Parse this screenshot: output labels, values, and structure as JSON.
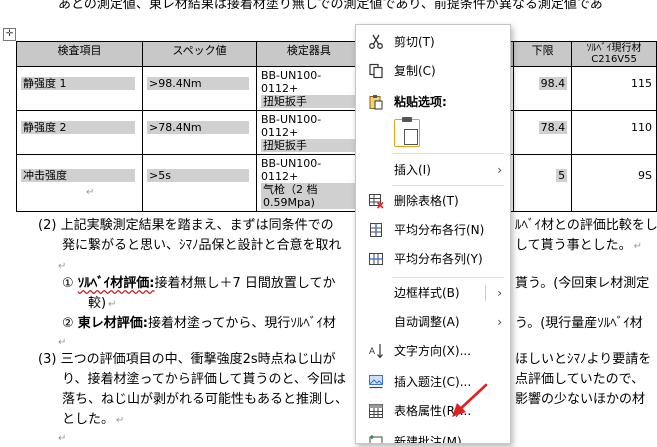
{
  "document": {
    "line_top": "あとの測定値、東レ材結果は接着材塗り無しでの測定値であり、前提条件が異なる測定値であ",
    "table": {
      "headers": [
        "検査項目",
        "スペック値",
        "検定器具",
        "",
        "下限",
        "ｿﾙﾍﾞｲ現行材 C216V55"
      ],
      "rows": [
        {
          "item": "静强度 1",
          "spec": ">98.4Nm",
          "tool_1": "BB-UN100-0112+",
          "tool_2": "扭矩扳手",
          "tool_3": "",
          "lower": "98.4",
          "current": "115"
        },
        {
          "item": "静强度 2",
          "spec": ">78.4Nm",
          "tool_1": "BB-UN100-0112+",
          "tool_2": "扭矩扳手",
          "tool_3": "",
          "lower": "78.4",
          "current": "110"
        },
        {
          "item": "冲击强度",
          "spec": ">5s",
          "tool_1": "BB-UN100-0112+",
          "tool_2": "气枪（2 档",
          "tool_3": "0.59Mpa)",
          "lower": "5",
          "current": "9S"
        }
      ]
    },
    "para2_num": "(2)",
    "para2_l1": "上記実験測定結果を踏まえ、まずは同条件での",
    "para2_l1b": "ﾙﾍﾞｲ材との評価比較をし",
    "para2_l2": "発に繋がると思い、ｼﾏﾉ品保と設計と合意を取れ",
    "para2_l2b": "して貰う事とした。",
    "item1_num": "①",
    "item1_bold": "ｿﾙﾍﾞｲ材評価:",
    "item1_text": "接着材無し＋7 日間放置してか",
    "item1_textb": "貰う。(今回東レ材測定",
    "item1_l2": "較)",
    "item2_num": "②",
    "item2_bold": "東レ材評価:",
    "item2_text": "接着材塗ってから、現行ｿﾙﾍﾞｲ材",
    "item2_textb": "う。(現行量産ｿﾙﾍﾞｲ材",
    "para3_num": "(3)",
    "para3_l1": "三つの評価項目の中、衝撃強度2s時点ねじ山が",
    "para3_l1b": "ほしいとｼﾏﾉより要請を",
    "para3_l2": "り、接着材塗ってから評価して貰うのと、今回は",
    "para3_l2b": "点評価していたので、",
    "para3_l3": "落ち、ねじ山が剥がれる可能性もあると推測し、",
    "para3_l3b": "影響の少ないほかの材",
    "para3_l4": "とした。"
  },
  "context_menu": {
    "items": [
      {
        "label": "剪切(T)",
        "icon": "scissors-icon"
      },
      {
        "label": "复制(C)",
        "icon": "copy-icon"
      },
      {
        "label": "粘贴选项:",
        "icon": "paste-icon"
      },
      {
        "label": "插入(I)",
        "icon": ""
      },
      {
        "label": "删除表格(T)",
        "icon": "delete-table-icon"
      },
      {
        "label": "平均分布各行(N)",
        "icon": "distribute-rows-icon"
      },
      {
        "label": "平均分布各列(Y)",
        "icon": "distribute-columns-icon"
      },
      {
        "label": "边框样式(B)",
        "icon": ""
      },
      {
        "label": "自动调整(A)",
        "icon": ""
      },
      {
        "label": "文字方向(X)...",
        "icon": "text-direction-icon"
      },
      {
        "label": "插入题注(C)...",
        "icon": "insert-caption-icon"
      },
      {
        "label": "表格属性(R)...",
        "icon": "table-properties-icon"
      },
      {
        "label": "新建批注(M)",
        "icon": "new-comment-icon"
      }
    ]
  },
  "colors": {
    "arrow": "#e02020",
    "paste_border": "#e3a21a",
    "wavy": "#cc2222"
  }
}
